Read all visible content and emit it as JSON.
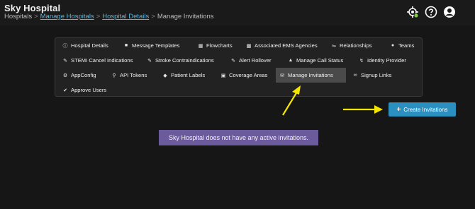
{
  "header": {
    "title": "Sky Hospital",
    "breadcrumb": {
      "root": "Hospitals",
      "links": [
        "Manage Hospitals",
        "Hospital Details"
      ],
      "current": "Manage Invitations",
      "separator": ">"
    },
    "icons": [
      "location-status-icon",
      "help-icon",
      "user-account-icon"
    ]
  },
  "tabs": [
    {
      "label": "Hospital Details",
      "icon": "info-circle-icon"
    },
    {
      "label": "Message Templates",
      "icon": "comments-icon"
    },
    {
      "label": "Flowcharts",
      "icon": "flowchart-icon"
    },
    {
      "label": "Associated EMS Agencies",
      "icon": "ambulance-icon"
    },
    {
      "label": "Relationships",
      "icon": "handshake-icon"
    },
    {
      "label": "Teams",
      "icon": "users-icon"
    },
    {
      "label": "STEMI Cancel Indications",
      "icon": "pencil-icon"
    },
    {
      "label": "Stroke Contraindications",
      "icon": "pencil-icon"
    },
    {
      "label": "Alert Rollover",
      "icon": "edit-icon"
    },
    {
      "label": "Manage Call Status",
      "icon": "bell-icon"
    },
    {
      "label": "Identity Provider",
      "icon": "identity-icon"
    },
    {
      "label": "AppConfig",
      "icon": "cogs-icon"
    },
    {
      "label": "API Tokens",
      "icon": "key-icon"
    },
    {
      "label": "Patient Labels",
      "icon": "tag-icon"
    },
    {
      "label": "Coverage Areas",
      "icon": "map-icon"
    },
    {
      "label": "Manage Invitations",
      "icon": "envelope-icon",
      "active": true
    },
    {
      "label": "Signup Links",
      "icon": "link-icon"
    },
    {
      "label": "Approve Users",
      "icon": "check-icon"
    }
  ],
  "actions": {
    "create_label": "Create Invitations"
  },
  "notice": {
    "text": "Sky Hospital does not have any active invitations."
  },
  "colors": {
    "background": "#161616",
    "tab_panel": "#222222",
    "active_tab": "#4a4a4a",
    "link": "#59b8e0",
    "button": "#2b8fc0",
    "notice": "#6b5a9c",
    "annotation_arrow": "#f5e600",
    "status_dot": "#7ac943"
  }
}
